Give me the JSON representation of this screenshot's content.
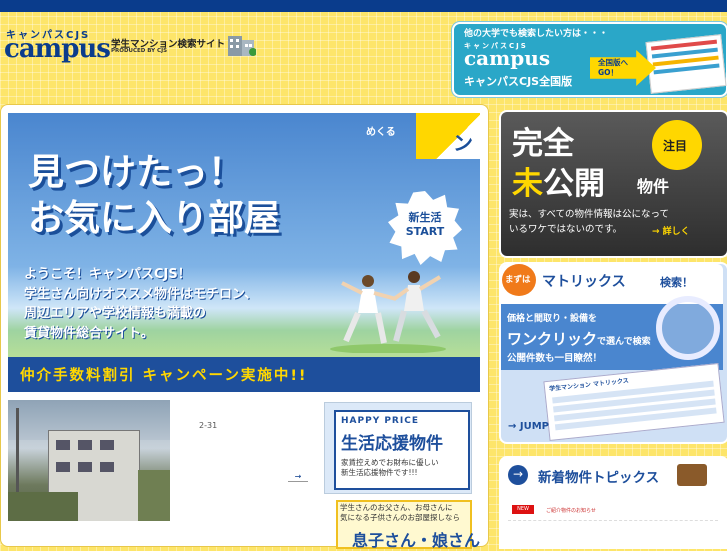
{
  "header": {
    "logo_kana": "キャンパスCJS",
    "logo": "campus",
    "tagline": "学生マンション検索サイト",
    "produced": "PRODUCED BY CJS"
  },
  "promo": {
    "top": "他の大学でも検索したい方は・・・",
    "kana": "キャンパスCJS",
    "logo": "campus",
    "name": "キャンパスCJS全国版",
    "cta_line1": "全国版へ",
    "cta_line2": "GO！"
  },
  "hero": {
    "mekuru": "めくる",
    "peel": "ン",
    "headline1": "見つけたっ！",
    "headline2": "お気に入り部屋",
    "burst_line1": "新生活",
    "burst_line2": "START",
    "intro1": "ようこそ！キャンパスCJS！",
    "intro2": "学生さん向けオススメ物件はモチロン、",
    "intro3": "周辺エリアや学校情報も満載の",
    "intro4": "賃貸物件総合サイト。",
    "banner": "仲介手数料割引 キャンペーン実施中!!"
  },
  "news": {
    "date": "2-31",
    "more": "→"
  },
  "happy": {
    "label": "HAPPY PRICE",
    "title": "生活応援物件",
    "desc1": "家賃控えめでお財布に優しい",
    "desc2": "新生活応援物件です!!!"
  },
  "parent": {
    "desc1": "学生さんのお父さん、お母さんに",
    "desc2": "気になる子供さんのお部屋探しなら",
    "title": "息子さん・娘さん"
  },
  "unreleased": {
    "line1": "完全",
    "line2a": "未",
    "line2b": "公開",
    "suffix": "物件",
    "badge": "注目",
    "desc1": "実は、すべての物件情報は公になって",
    "desc2": "いるワケではないのです。",
    "link": "→ 詳しく"
  },
  "matrix": {
    "badge": "まずは",
    "title": "マトリックス",
    "title2": "検索！",
    "p1": "価格と間取り・設備を",
    "one_click": "ワンクリック",
    "p2": "で選んで検索",
    "p3": "公開件数も一目瞭然！",
    "sheet": "学生マンション マトリックス",
    "jump": "→ JUMP"
  },
  "topics": {
    "title": "新着物件トピックス",
    "badge": "NEW",
    "item": "ご紹介物件のお知らせ"
  }
}
